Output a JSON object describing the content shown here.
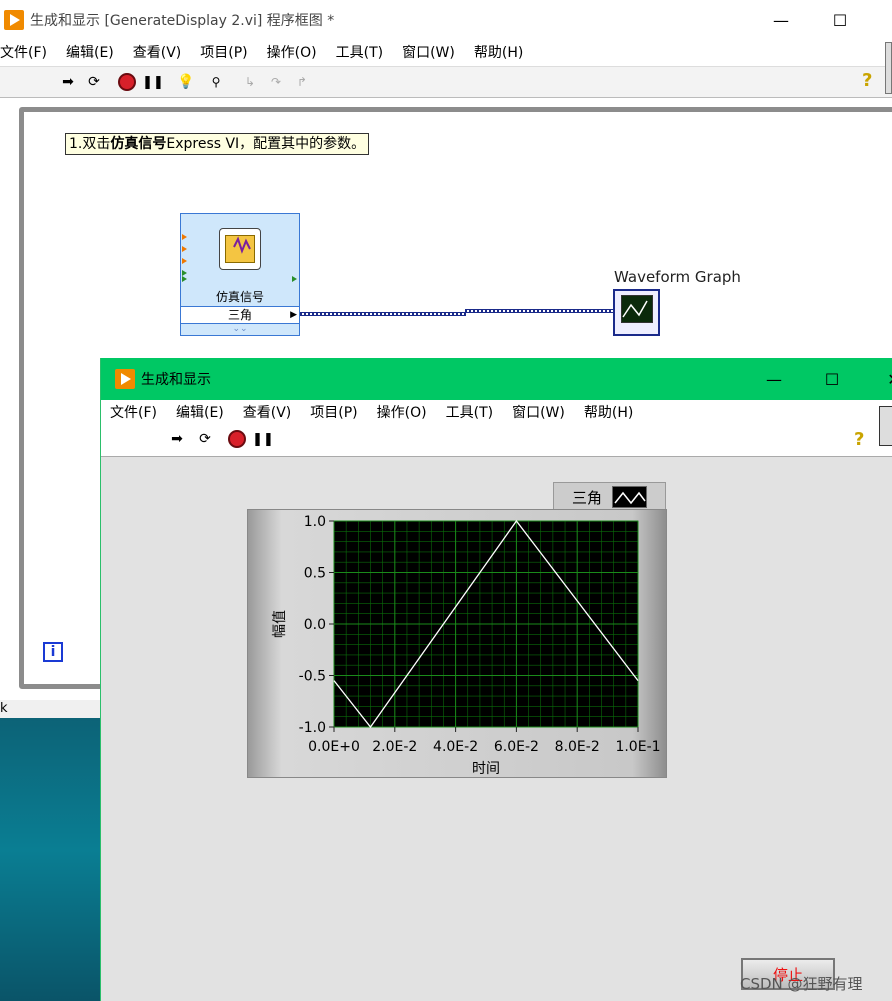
{
  "back_window": {
    "title": "生成和显示 [GenerateDisplay 2.vi] 程序框图 *",
    "menu": [
      "文件(F)",
      "编辑(E)",
      "查看(V)",
      "项目(P)",
      "操作(O)",
      "工具(T)",
      "窗口(W)",
      "帮助(H)"
    ],
    "instruction": {
      "prefix": "1.双击",
      "bold": "仿真信号",
      "suffix": "Express VI，配置其中的参数。"
    },
    "express_vi": {
      "label": "仿真信号",
      "value": "三角"
    },
    "graph_label": "Waveform Graph",
    "info_glyph": "i",
    "taskbar_glyph": "k"
  },
  "front_window": {
    "title": "生成和显示",
    "menu": [
      "文件(F)",
      "编辑(E)",
      "查看(V)",
      "项目(P)",
      "操作(O)",
      "工具(T)",
      "窗口(W)",
      "帮助(H)"
    ],
    "legend_name": "三角",
    "stop_label": "停止"
  },
  "chart_data": {
    "type": "line",
    "xlabel": "时间",
    "ylabel": "幅值",
    "xlim": [
      0,
      0.1
    ],
    "ylim": [
      -1,
      1
    ],
    "xticks": [
      "0.0E+0",
      "2.0E-2",
      "4.0E-2",
      "6.0E-2",
      "8.0E-2",
      "1.0E-1"
    ],
    "yticks": [
      "1.0",
      "0.5",
      "0.0",
      "-0.5",
      "-1.0"
    ],
    "grid": true,
    "series": [
      {
        "name": "三角",
        "x": [
          0,
          0.012,
          0.06,
          0.1
        ],
        "y": [
          -0.55,
          -1.0,
          1.0,
          -0.55
        ]
      }
    ]
  },
  "watermark": "CSDN @狂野有理",
  "colors": {
    "front_title_bar": "#00c864",
    "plot_bg": "#000000",
    "grid": "#0b6a0b",
    "trace": "#ffffff",
    "diagram_border": "#8c8c8c"
  }
}
